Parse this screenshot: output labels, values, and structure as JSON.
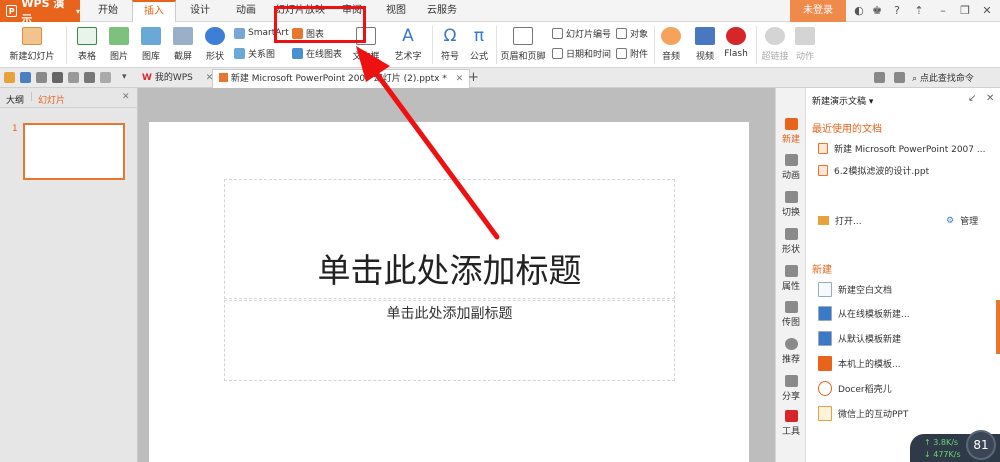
{
  "app": {
    "name": "WPS 演示",
    "login_label": "未登录"
  },
  "menu_tabs": [
    "开始",
    "插入",
    "设计",
    "动画",
    "幻灯片放映",
    "审阅",
    "视图",
    "云服务"
  ],
  "active_menu": "插入",
  "ribbon": {
    "new_slide": "新建幻灯片",
    "table": "表格",
    "picture": "图片",
    "gallery": "图库",
    "screenshot": "截屏",
    "shape": "形状",
    "smartart": "SmartArt",
    "chart": "图表",
    "relation": "关系图",
    "online_chart": "在线图表",
    "textbox": "文本框",
    "wordart": "艺术字",
    "symbol": "符号",
    "formula": "公式",
    "header_footer": "页眉和页脚",
    "slide_number": "幻灯片编号",
    "object": "对象",
    "datetime": "日期和时间",
    "attachment": "附件",
    "audio": "音频",
    "video": "视频",
    "flash": "Flash",
    "hyperlink": "超链接",
    "action": "动作"
  },
  "doc_tabs": [
    {
      "label": "我的WPS"
    },
    {
      "label": "新建 Microsoft PowerPoint 2007 幻灯片 (2).pptx *"
    }
  ],
  "toolbar_search": "点此查找命令",
  "left_pane": {
    "tab_outline": "大纲",
    "tab_slides": "幻灯片",
    "slide_number": "1"
  },
  "slide": {
    "title_placeholder": "单击此处添加标题",
    "subtitle_placeholder": "单击此处添加副标题"
  },
  "right_strip": [
    "新建",
    "动画",
    "切换",
    "形状",
    "属性",
    "传图",
    "推荐",
    "分享",
    "工具"
  ],
  "task_pane": {
    "header": "新建演示文稿",
    "recent_title": "最近使用的文档",
    "recent": [
      "新建 Microsoft PowerPoint 2007 ...",
      "6.2模拟滤波的设计.ppt"
    ],
    "open_label": "打开...",
    "manage_label": "管理",
    "new_title": "新建",
    "new_items": [
      "新建空白文档",
      "从在线模板新建...",
      "从默认模板新建",
      "本机上的模板...",
      "Docer稻壳儿",
      "微信上的互动PPT"
    ]
  },
  "speed_widget": {
    "up": "3.8K/s",
    "down": "477K/s",
    "percent": "81"
  },
  "colors": {
    "accent": "#e8631c",
    "annotation": "#e11111"
  }
}
